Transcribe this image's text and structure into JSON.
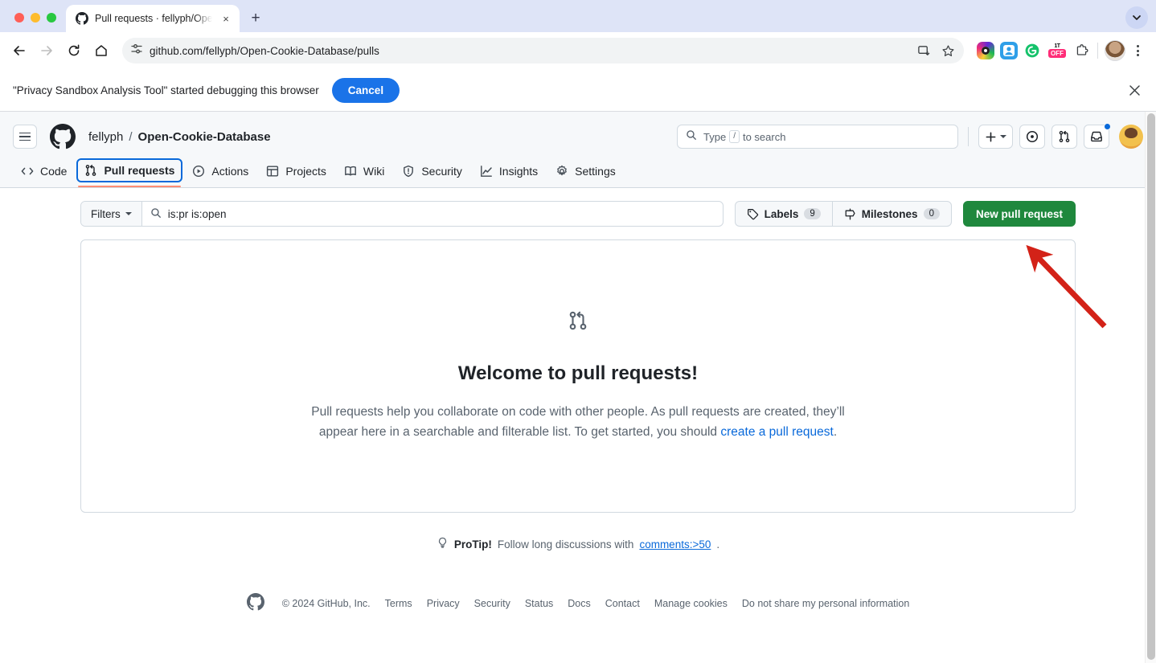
{
  "browser": {
    "tab": {
      "title": "Pull requests · fellyph/Open-C",
      "favicon": "github-icon",
      "close": "×"
    },
    "new_tab_label": "+",
    "tab_search": "chevron-down-icon",
    "nav": {
      "back": "back-icon",
      "forward": "forward-icon",
      "reload": "reload-icon",
      "home": "home-icon"
    },
    "omnibox": {
      "site_settings_icon": "site-settings-icon",
      "url": "github.com/fellyph/Open-Cookie-Database/pulls",
      "install_icon": "install-app-icon",
      "bookmark_icon": "star-icon"
    },
    "extensions": [
      {
        "name": "instagram-extension-icon"
      },
      {
        "name": "contact-extension-icon"
      },
      {
        "name": "grammarly-extension-icon",
        "label": "G"
      },
      {
        "name": "privacy-off-extension-icon",
        "label_top": "1T",
        "label": "OFF"
      },
      {
        "name": "extensions-puzzle-icon"
      }
    ],
    "profile_icon": "chrome-profile-avatar",
    "menu_icon": "chrome-menu-icon"
  },
  "infobar": {
    "message": "\"Privacy Sandbox Analysis Tool\" started debugging this browser",
    "cancel_label": "Cancel",
    "close_icon": "close-icon",
    "accent_color": "#1a73e8"
  },
  "github": {
    "hamburger_icon": "hamburger-menu-icon",
    "logo_icon": "github-logo-icon",
    "breadcrumb": {
      "owner": "fellyph",
      "separator": "/",
      "repo": "Open-Cookie-Database"
    },
    "search": {
      "placeholder_prefix": "Type",
      "key": "/",
      "placeholder_suffix": "to search",
      "icon": "search-icon"
    },
    "create_new": {
      "icon": "plus-icon",
      "caret": "chevron-down-icon"
    },
    "issues_icon": "issues-icon",
    "pull_requests_icon": "pull-request-icon",
    "inbox_icon": "inbox-icon",
    "avatar": "user-avatar",
    "nav": [
      {
        "label": "Code",
        "icon": "code-icon",
        "active": false
      },
      {
        "label": "Pull requests",
        "icon": "pull-request-icon",
        "active": true
      },
      {
        "label": "Actions",
        "icon": "play-circle-icon",
        "active": false
      },
      {
        "label": "Projects",
        "icon": "table-icon",
        "active": false
      },
      {
        "label": "Wiki",
        "icon": "book-icon",
        "active": false
      },
      {
        "label": "Security",
        "icon": "shield-icon",
        "active": false
      },
      {
        "label": "Insights",
        "icon": "graph-icon",
        "active": false
      },
      {
        "label": "Settings",
        "icon": "gear-icon",
        "active": false
      }
    ]
  },
  "toolbar": {
    "filters_label": "Filters",
    "search_value": "is:pr is:open",
    "search_icon": "search-icon",
    "labels": {
      "label": "Labels",
      "count": "9",
      "icon": "tag-icon"
    },
    "milestones": {
      "label": "Milestones",
      "count": "0",
      "icon": "milestone-icon"
    },
    "new_pull_request": "New pull request",
    "new_pr_color": "#1f883d"
  },
  "blankslate": {
    "icon": "pull-request-icon",
    "title": "Welcome to pull requests!",
    "description_1": "Pull requests help you collaborate on code with other people. As pull requests are created, they’ll appear here in a searchable and filterable list. To get started, you should ",
    "link_text": "create a pull request",
    "description_2": "."
  },
  "protip": {
    "icon": "lightbulb-icon",
    "prefix": "ProTip!",
    "text": "Follow long discussions with",
    "link": "comments:>50",
    "suffix": "."
  },
  "footer": {
    "logo_icon": "github-mark-icon",
    "copyright": "© 2024 GitHub, Inc.",
    "links": [
      "Terms",
      "Privacy",
      "Security",
      "Status",
      "Docs",
      "Contact",
      "Manage cookies",
      "Do not share my personal information"
    ]
  },
  "annotation": {
    "arrow_color": "#d32218",
    "points_to": "New pull request"
  }
}
